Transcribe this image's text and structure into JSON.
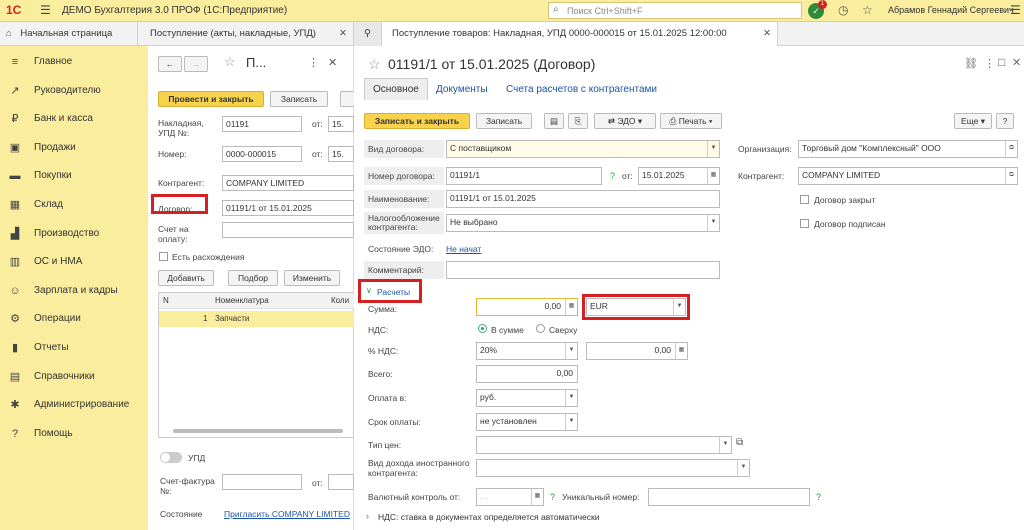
{
  "app": {
    "logo": "1С",
    "title": "ДЕМО Бухгалтерия 3.0 ПРОФ  (1С:Предприятие)",
    "search_placeholder": "Поиск Ctrl+Shift+F",
    "notif_count": "1",
    "user": "Абрамов Геннадий Сергеевич"
  },
  "tabs": [
    {
      "label": "Начальная страница"
    },
    {
      "label": "Поступление (акты, накладные, УПД)"
    },
    {
      "label": "Поступление товаров: Накладная, УПД 0000-000015 от 15.01.2025 12:00:00"
    }
  ],
  "sidebar": {
    "items": [
      {
        "label": "Главное",
        "icon": "menu-icon"
      },
      {
        "label": "Руководителю",
        "icon": "chart-icon"
      },
      {
        "label": "Банк и касса",
        "icon": "ruble-icon"
      },
      {
        "label": "Продажи",
        "icon": "cart-icon"
      },
      {
        "label": "Покупки",
        "icon": "basket-icon"
      },
      {
        "label": "Склад",
        "icon": "warehouse-icon"
      },
      {
        "label": "Производство",
        "icon": "factory-icon"
      },
      {
        "label": "ОС и НМА",
        "icon": "building-icon"
      },
      {
        "label": "Зарплата и кадры",
        "icon": "people-icon"
      },
      {
        "label": "Операции",
        "icon": "operations-icon"
      },
      {
        "label": "Отчеты",
        "icon": "reports-icon"
      },
      {
        "label": "Справочники",
        "icon": "book-icon"
      },
      {
        "label": "Администрирование",
        "icon": "gear-icon"
      },
      {
        "label": "Помощь",
        "icon": "help-icon"
      }
    ]
  },
  "doc": {
    "title": "П...",
    "post_close": "Провести и закрыть",
    "save": "Записать",
    "invoice_label": "Накладная, УПД №:",
    "invoice_value": "01191",
    "from": "от:",
    "from_value": "15.",
    "number_label": "Номер:",
    "number_value": "0000-000015",
    "contractor_label": "Контрагент:",
    "contractor_value": "COMPANY LIMITED",
    "contract_label": "Договор:",
    "contract_value": "01191/1 от 15.01.2025",
    "pay_invoice_label": "Счет на оплату:",
    "discrepancy": "Есть расхождения",
    "add": "Добавить",
    "select": "Подбор",
    "change": "Изменить",
    "col_n": "N",
    "col_item": "Номенклатура",
    "col_qty": "Коли",
    "row_n": "1",
    "row_item": "Запчасти",
    "upd": "УПД",
    "sf_label": "Счет-фактура №:",
    "sf_from": "от:",
    "state_label": "Состояние",
    "state_link": "Пригласить COMPANY LIMITED"
  },
  "contract": {
    "title": "01191/1 от 15.01.2025 (Договор)",
    "tabs": [
      "Основное",
      "Документы",
      "Счета расчетов с контрагентами"
    ],
    "save_close": "Записать и закрыть",
    "save": "Записать",
    "edo": "ЭДО",
    "print": "Печать",
    "more": "Еще",
    "help": "?",
    "kind_label": "Вид договора:",
    "kind_value": "С поставщиком",
    "number_label": "Номер договора:",
    "number_value": "01191/1",
    "from_label": "от:",
    "date_value": "15.01.2025",
    "name_label": "Наименование:",
    "name_value": "01191/1 от 15.01.2025",
    "tax_label": "Налогообложение контрагента:",
    "tax_value": "Не выбрано",
    "edo_state_label": "Состояние ЭДО:",
    "edo_state_value": "Не начат",
    "comment_label": "Комментарий:",
    "org_label": "Организация:",
    "org_value": "Торговый дом \"Комплексный\" ООО",
    "contractor_label": "Контрагент:",
    "contractor_value": "COMPANY LIMITED",
    "closed": "Договор закрыт",
    "signed": "Договор подписан",
    "calc_section": "Расчеты",
    "sum_label": "Сумма:",
    "sum_value": "0,00",
    "currency": "EUR",
    "vat_label": "НДС:",
    "vat_in": "В сумме",
    "vat_over": "Сверху",
    "vat_pct_label": "% НДС:",
    "vat_pct": "20%",
    "vat_amount": "0,00",
    "total_label": "Всего:",
    "total_value": "0,00",
    "pay_in_label": "Оплата в:",
    "pay_in_value": "руб.",
    "term_label": "Срок оплаты:",
    "term_value": "не установлен",
    "price_type_label": "Тип цен:",
    "income_label": "Вид дохода иностранного контрагента:",
    "currency_ctrl_label": "Валютный контроль от:",
    "currency_ctrl_value": ". .",
    "unique_label": "Уникальный номер:",
    "vat_section": "НДС: ставка в документах определяется автоматически"
  }
}
